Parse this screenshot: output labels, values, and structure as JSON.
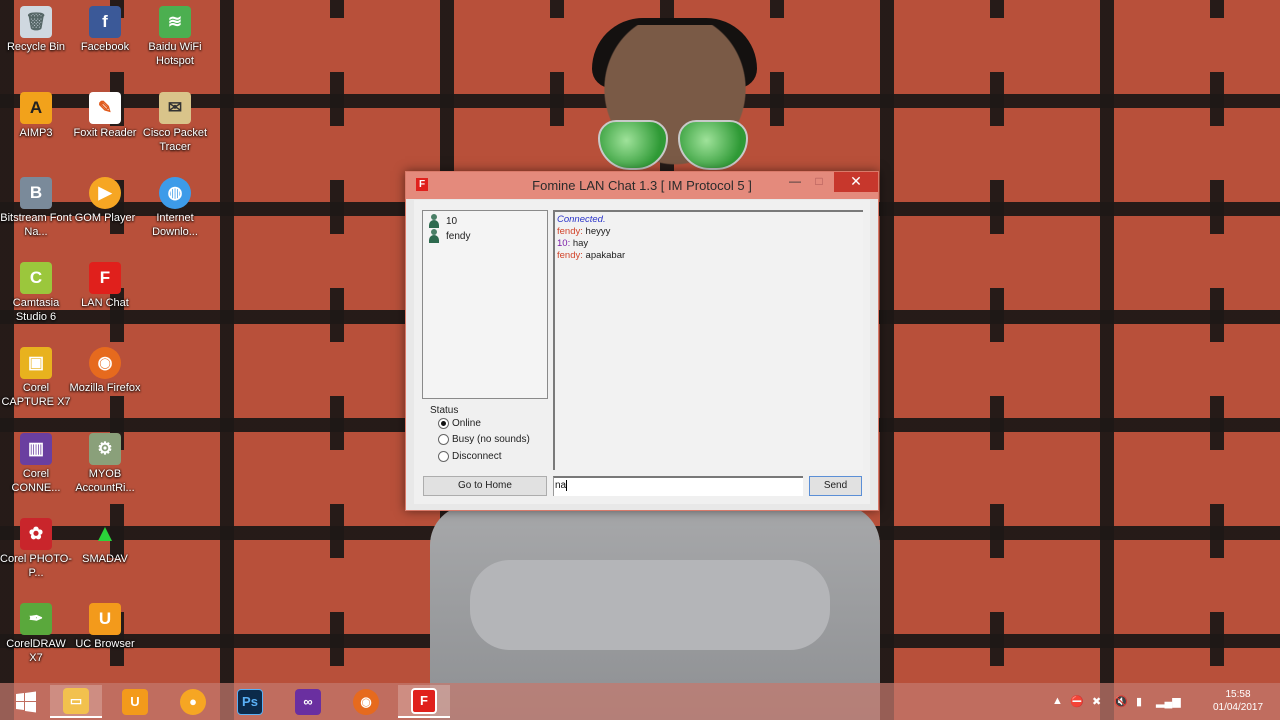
{
  "desktop": {
    "icons": [
      {
        "label": "Recycle Bin"
      },
      {
        "label": "Facebook"
      },
      {
        "label": "Baidu WiFi Hotspot"
      },
      {
        "label": "AIMP3"
      },
      {
        "label": "Foxit Reader"
      },
      {
        "label": "Cisco Packet Tracer"
      },
      {
        "label": "Bitstream Font Na..."
      },
      {
        "label": "GOM Player"
      },
      {
        "label": "Internet Downlo..."
      },
      {
        "label": "Camtasia Studio 6"
      },
      {
        "label": "LAN Chat"
      },
      {
        "label": "Corel CAPTURE X7"
      },
      {
        "label": "Mozilla Firefox"
      },
      {
        "label": "Corel CONNE..."
      },
      {
        "label": "MYOB AccountRi..."
      },
      {
        "label": "Corel PHOTO-P..."
      },
      {
        "label": "SMADAV"
      },
      {
        "label": "CorelDRAW X7"
      },
      {
        "label": "UC Browser"
      }
    ]
  },
  "window": {
    "title": "Fomine LAN Chat 1.3   [ IM Protocol 5 ]",
    "app_icon": "F",
    "minimize": "—",
    "maximize": "□",
    "close": "✕",
    "users": [
      {
        "name": "10"
      },
      {
        "name": "fendy"
      }
    ],
    "status": {
      "legend": "Status",
      "options": [
        {
          "label": "Online",
          "selected": true
        },
        {
          "label": "Busy (no sounds)",
          "selected": false
        },
        {
          "label": "Disconnect",
          "selected": false
        }
      ]
    },
    "chat": {
      "connected": "Connected.",
      "messages": [
        {
          "name": "fendy",
          "text": " heyyy"
        },
        {
          "name": "10",
          "text": " hay"
        },
        {
          "name": "fendy",
          "text": " apakabar"
        }
      ],
      "separator": ":"
    },
    "home_button": "Go to Home",
    "message_input": "na",
    "send_button": "Send"
  },
  "taskbar": {
    "ps_label": "Ps",
    "lanchat_label": "F",
    "clock_time": "15:58",
    "clock_date": "01/04/2017"
  },
  "colors": {
    "accent_title": "#e48a7c",
    "close_red": "#c7372c",
    "connected_blue": "#2a33c9",
    "fendy_red": "#d2442a",
    "user10_purple": "#7a1ba8"
  }
}
